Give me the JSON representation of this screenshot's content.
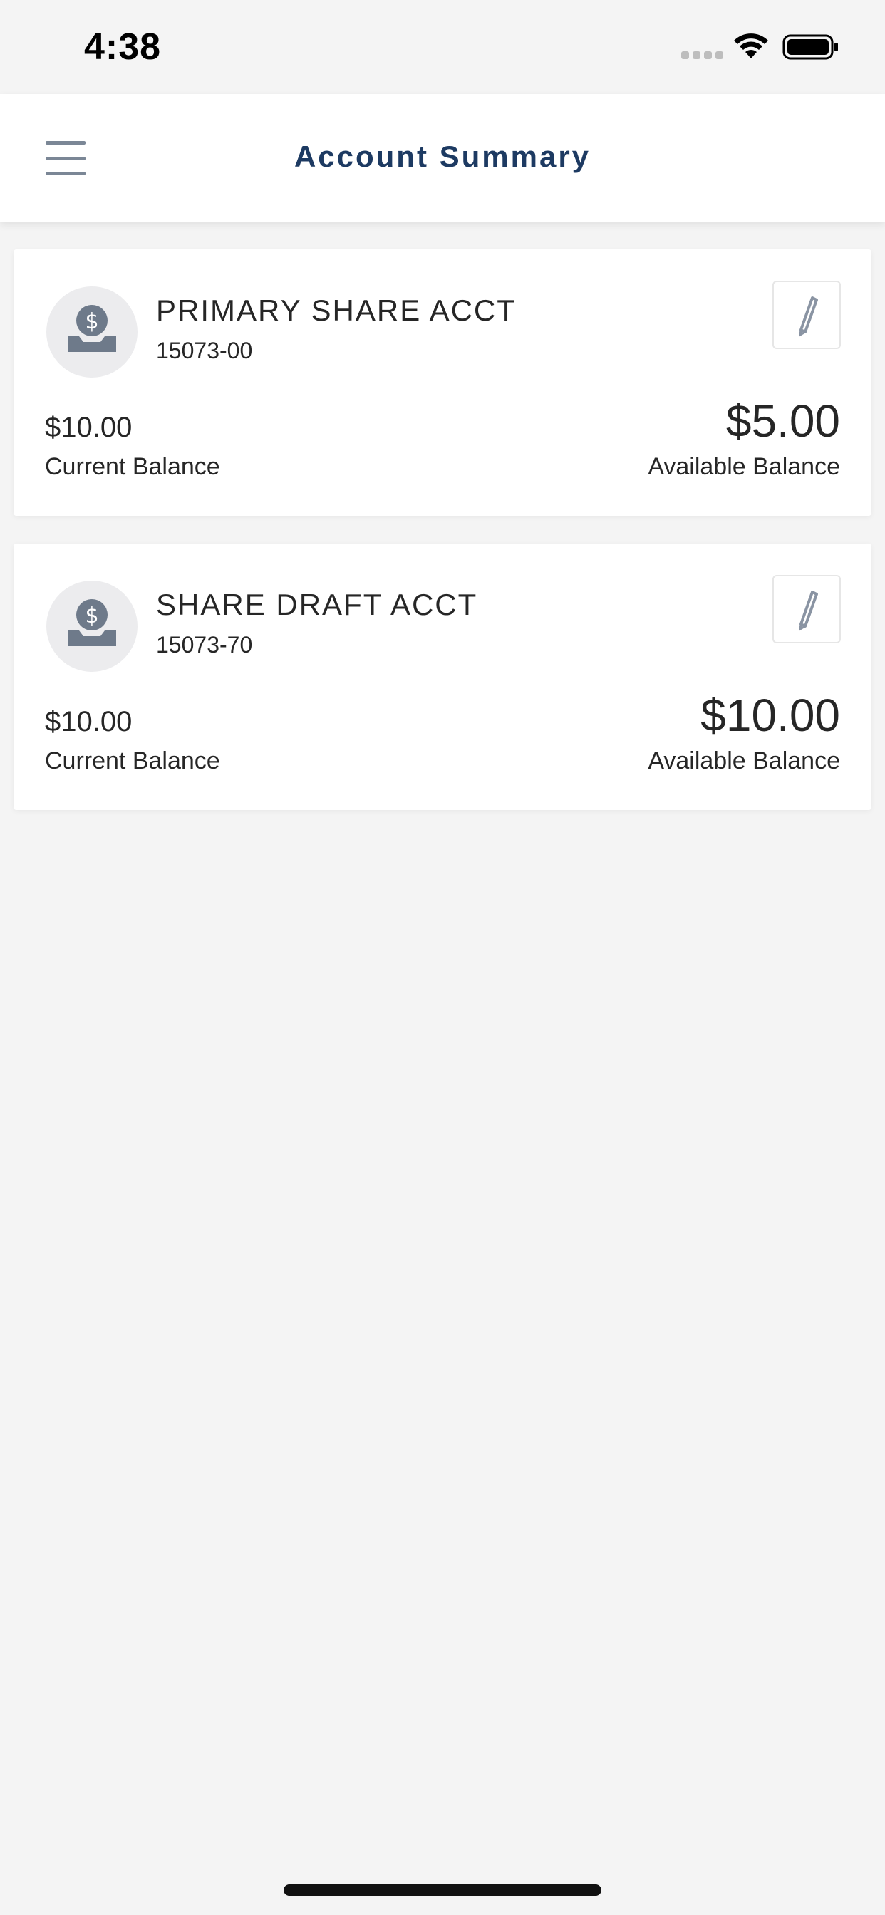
{
  "status_bar": {
    "time": "4:38"
  },
  "header": {
    "title": "Account Summary",
    "menu_icon": "hamburger-menu-icon"
  },
  "accounts": [
    {
      "name": "PRIMARY SHARE ACCT",
      "number": "15073-00",
      "current_balance": "$10.00",
      "current_balance_label": "Current Balance",
      "available_balance": "$5.00",
      "available_balance_label": "Available Balance",
      "icon": "money-dollar-icon"
    },
    {
      "name": "SHARE DRAFT ACCT",
      "number": "15073-70",
      "current_balance": "$10.00",
      "current_balance_label": "Current Balance",
      "available_balance": "$10.00",
      "available_balance_label": "Available Balance",
      "icon": "money-dollar-icon"
    }
  ],
  "colors": {
    "title": "#1d3a62",
    "icon_gray": "#7b8796",
    "background": "#f4f4f4",
    "card": "#ffffff"
  }
}
